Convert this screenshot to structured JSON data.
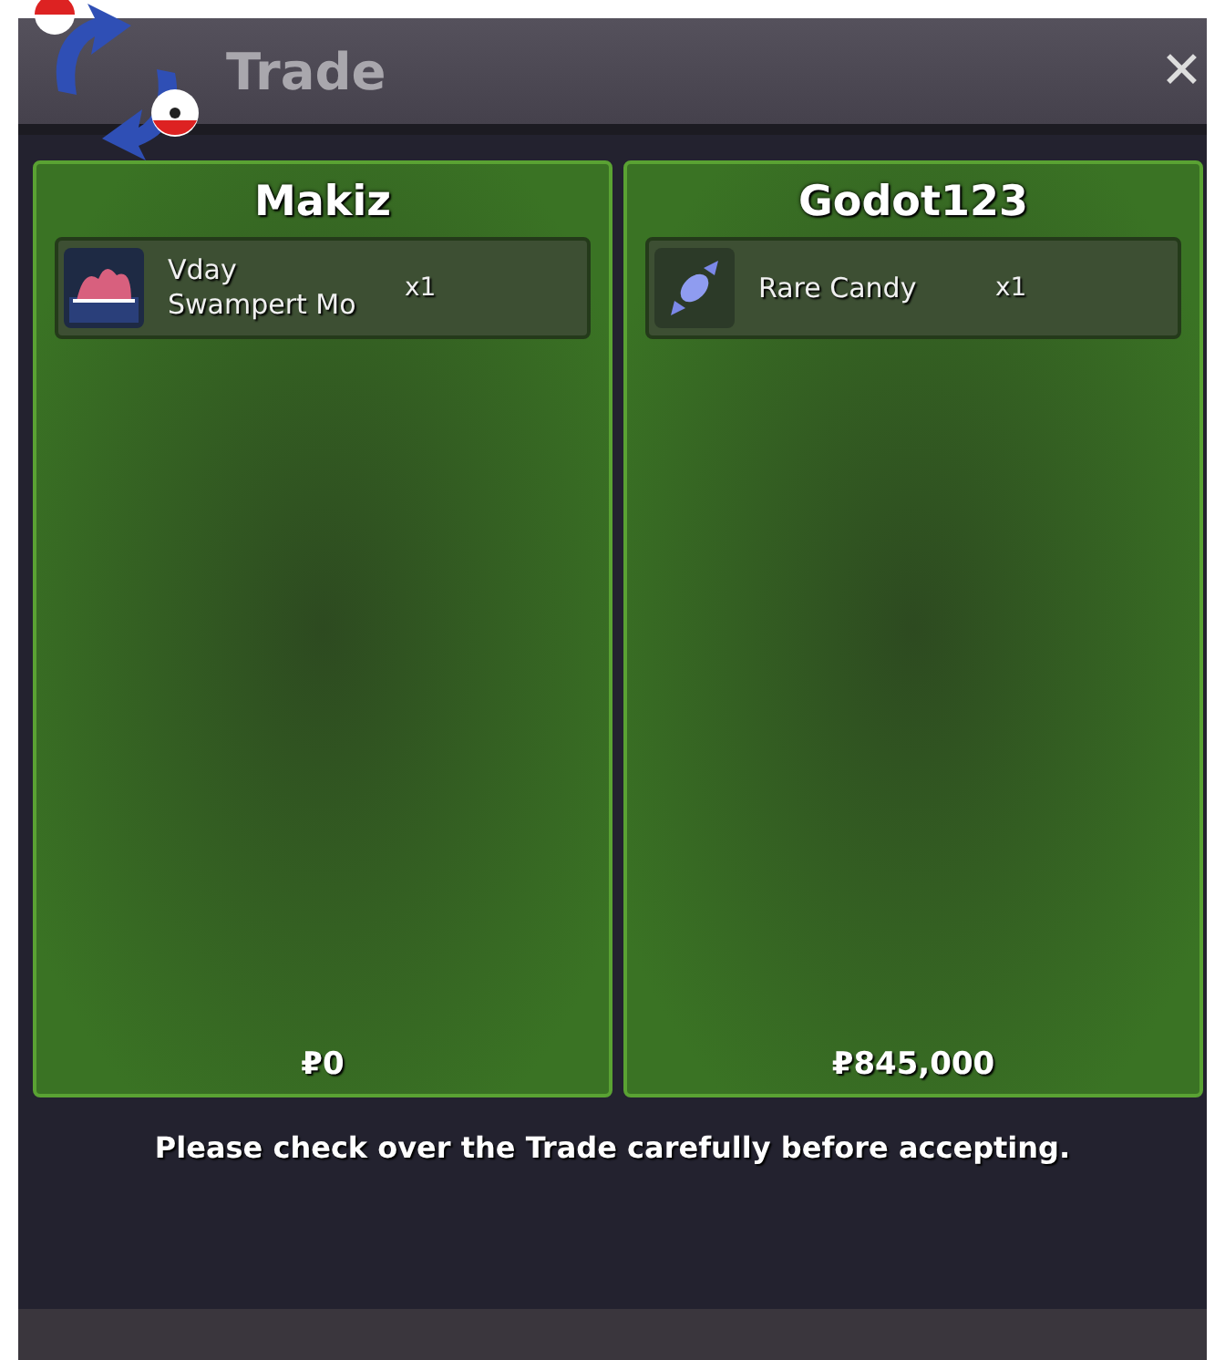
{
  "window": {
    "title": "Trade",
    "close": "✕"
  },
  "panels": [
    {
      "player": "Makiz",
      "items": [
        {
          "kind": "pokemon",
          "name": "Vday Swampert Mo",
          "quantity": "x1"
        }
      ],
      "money": "₽0"
    },
    {
      "player": "Godot123",
      "items": [
        {
          "kind": "candy",
          "name": "Rare Candy",
          "quantity": "x1"
        }
      ],
      "money": "₽845,000"
    }
  ],
  "message": "Please check over the Trade carefully before accepting."
}
